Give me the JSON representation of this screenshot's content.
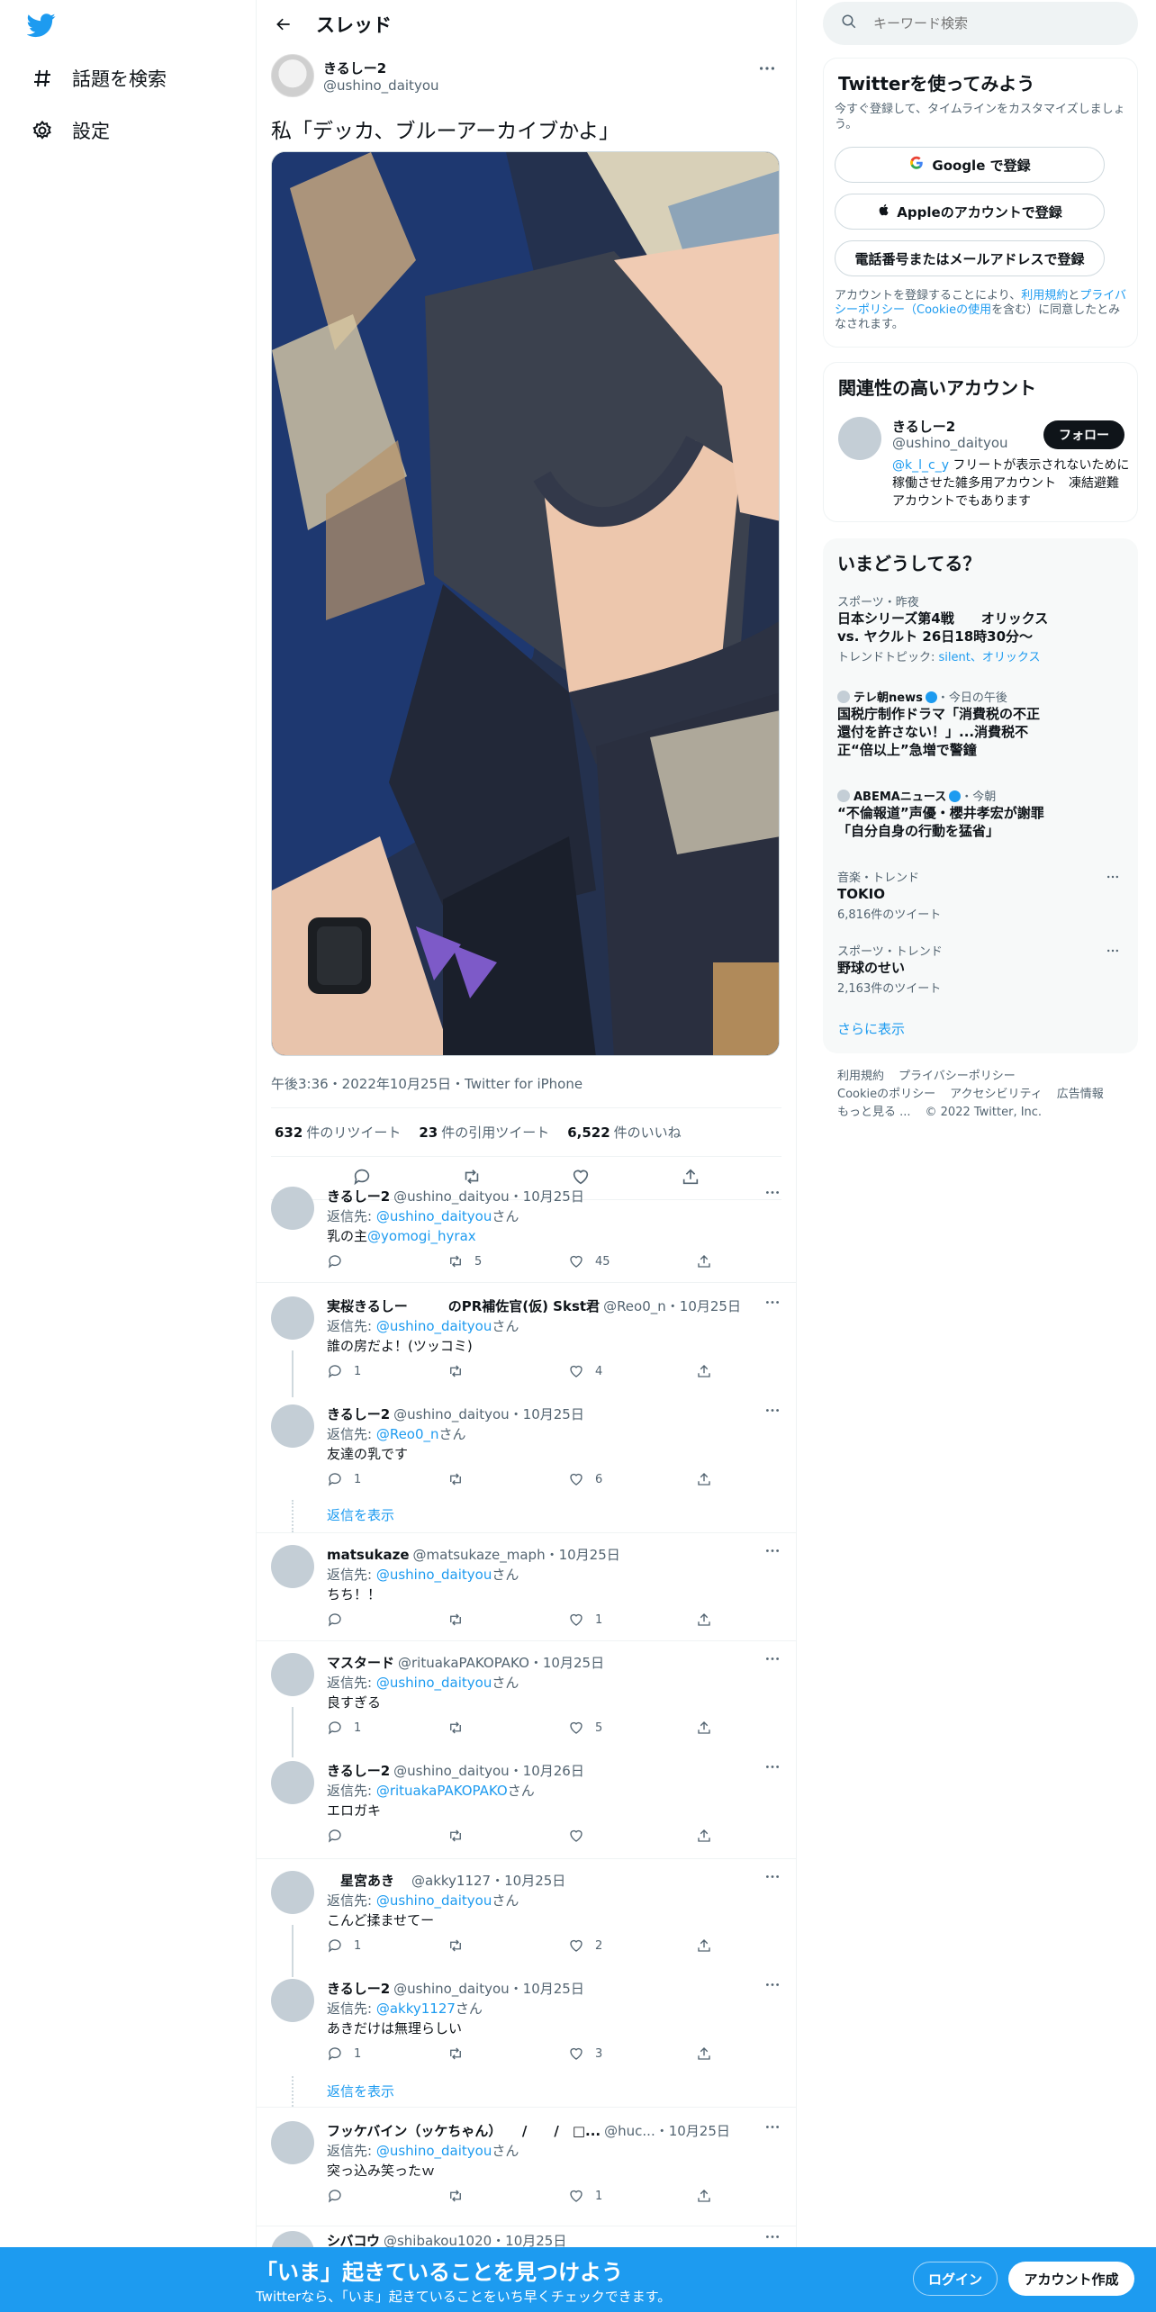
{
  "nav": {
    "explore_label": "話題を検索",
    "settings_label": "設定"
  },
  "thread": {
    "header_title": "スレッド",
    "author_name": "きるしー2",
    "author_handle": "@ushino_daityou",
    "text": "私「デッカ、ブルーアーカイブかよ」",
    "meta": "午後3:36・2022年10月25日・Twitter for iPhone",
    "stats": {
      "retweets_num": "632",
      "retweets_label": "件のリツイート",
      "quotes_num": "23",
      "quotes_label": "件の引用ツイート",
      "likes_num": "6,522",
      "likes_label": "件のいいね"
    }
  },
  "replies": [
    {
      "name": "きるしー2",
      "handle": "@ushino_daityou",
      "date": "・10月25日",
      "to_prefix": "返信先: ",
      "to": "@ushino_daityou",
      "to_suffix": "さん",
      "body": "乳の主",
      "body_link": "@yomogi_hyrax",
      "replies": "",
      "retweets": "5",
      "likes": "45"
    },
    {
      "name": "実桜きるしー　　　のPR補佐官(仮) Skst君",
      "handle": "@Reo0_n",
      "date": "・10月25日",
      "to_prefix": "返信先: ",
      "to": "@ushino_daityou",
      "to_suffix": "さん",
      "body": "誰の房だよ！(ツッコミ)",
      "body_link": "",
      "replies": "1",
      "retweets": "",
      "likes": "4"
    },
    {
      "name": "きるしー2",
      "handle": "@ushino_daityou",
      "date": "・10月25日",
      "to_prefix": "返信先: ",
      "to": "@Reo0_n",
      "to_suffix": "さん",
      "body": "友達の乳です",
      "body_link": "",
      "replies": "1",
      "retweets": "",
      "likes": "6"
    },
    {
      "name": "matsukaze",
      "handle": "@matsukaze_maph",
      "date": "・10月25日",
      "to_prefix": "返信先: ",
      "to": "@ushino_daityou",
      "to_suffix": "さん",
      "body": "ちち！！",
      "body_link": "",
      "replies": "",
      "retweets": "",
      "likes": "1"
    },
    {
      "name": "マスタード",
      "handle": "@rituakaPAKOPAKO",
      "date": "・10月25日",
      "to_prefix": "返信先: ",
      "to": "@ushino_daityou",
      "to_suffix": "さん",
      "body": "良すぎる",
      "body_link": "",
      "replies": "1",
      "retweets": "",
      "likes": "5"
    },
    {
      "name": "きるしー2",
      "handle": "@ushino_daityou",
      "date": "・10月26日",
      "to_prefix": "返信先: ",
      "to": "@rituakaPAKOPAKO",
      "to_suffix": "さん",
      "body": "エロガキ",
      "body_link": "",
      "replies": "",
      "retweets": "",
      "likes": ""
    },
    {
      "name": "　星宮あき　",
      "handle": "@akky1127",
      "date": "・10月25日",
      "to_prefix": "返信先: ",
      "to": "@ushino_daityou",
      "to_suffix": "さん",
      "body": "こんど揉ませてー",
      "body_link": "",
      "replies": "1",
      "retweets": "",
      "likes": "2"
    },
    {
      "name": "きるしー2",
      "handle": "@ushino_daityou",
      "date": "・10月25日",
      "to_prefix": "返信先: ",
      "to": "@akky1127",
      "to_suffix": "さん",
      "body": "あきだけは無理らしい",
      "body_link": "",
      "replies": "1",
      "retweets": "",
      "likes": "3"
    },
    {
      "name": "フッケバイン（ッケちゃん）　　/　　/　□...",
      "handle": "@huc...",
      "date": "・10月25日",
      "to_prefix": "返信先: ",
      "to": "@ushino_daityou",
      "to_suffix": "さん",
      "body": "突っ込み笑ったｗ",
      "body_link": "",
      "replies": "",
      "retweets": "",
      "likes": "1"
    },
    {
      "name": "シバコウ",
      "handle": "@shibakou1020",
      "date": "・10月25日",
      "to_prefix": "",
      "to": "",
      "to_suffix": "",
      "body": "",
      "body_link": "",
      "replies": "",
      "retweets": "",
      "likes": ""
    }
  ],
  "show_replies_label": "返信を表示",
  "right": {
    "search_placeholder": "キーワード検索",
    "signup": {
      "title": "Twitterを使ってみよう",
      "desc": "今すぐ登録して、タイムラインをカスタマイズしましょう。",
      "google_label": "Google で登録",
      "apple_label": "Appleのアカウントで登録",
      "phone_label": "電話番号またはメールアドレスで登録",
      "legal_prefix": "アカウントを登録することにより、",
      "legal_terms": "利用規約",
      "legal_and": "と",
      "legal_privacy": "プライバシーポリシー",
      "legal_cookie": "（Cookieの使用",
      "legal_suffix": "を含む）に同意したとみなされます。"
    },
    "related": {
      "title": "関連性の高いアカウント",
      "name": "きるしー2",
      "handle": "@ushino_daityou",
      "follow_label": "フォロー",
      "bio_link": "@k_l_c_y",
      "bio": " フリートが表示されないために稼働させた雑多用アカウント　凍結避難アカウントでもあります"
    },
    "trends": {
      "title": "いまどうしてる？",
      "items": [
        {
          "cat": "スポーツ・昨夜",
          "title": "日本シリーズ第4戦　　オリックス vs. ヤクルト 26日18時30分〜",
          "sub_prefix": "トレンドトピック: ",
          "sub_link": "silent、オリックス"
        },
        {
          "cat": "テレ朝news",
          "cat_suffix": "・今日の午後",
          "title": "国税庁制作ドラマ「消費税の不正還付を許さない！」...消費税不正“倍以上”急増で警鐘"
        },
        {
          "cat": "ABEMAニュース",
          "cat_suffix": "・今朝",
          "title": "“不倫報道”声優・櫻井孝宏が謝罪「自分自身の行動を猛省」"
        },
        {
          "cat": "音楽・トレンド",
          "title": "TOKIO",
          "sub": "6,816件のツイート"
        },
        {
          "cat": "スポーツ・トレンド",
          "title": "野球のせい",
          "sub": "2,163件のツイート"
        }
      ],
      "more_label": "さらに表示"
    },
    "footer": {
      "terms": "利用規約",
      "privacy": "プライバシーポリシー",
      "cookie": "Cookieのポリシー",
      "accessibility": "アクセシビリティ",
      "ads": "広告情報",
      "more": "もっと見る ...",
      "copyright": "© 2022 Twitter, Inc."
    }
  },
  "bottom_bar": {
    "title": "「いま」起きていることを見つけよう",
    "subtitle": "Twitterなら、「いま」起きていることをいち早くチェックできます。",
    "login_label": "ログイン",
    "signup_label": "アカウント作成"
  },
  "colors": {
    "accent": "#1d9bf0",
    "text": "#0f1419",
    "muted": "#536471"
  }
}
